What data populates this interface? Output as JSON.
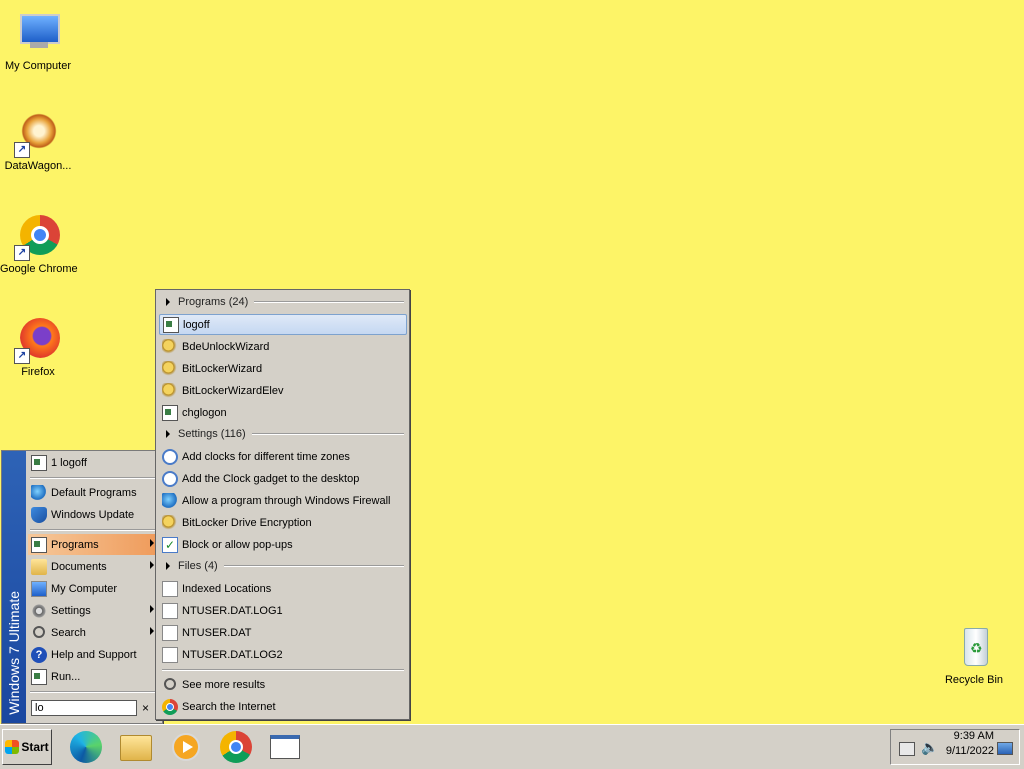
{
  "desktop": {
    "icons": [
      {
        "label": "My Computer"
      },
      {
        "label": "DataWagon..."
      },
      {
        "label": "Google Chrome"
      },
      {
        "label": "Firefox"
      },
      {
        "label": "Recycle Bin"
      }
    ]
  },
  "start_menu": {
    "band_text": "Windows 7 Ultimate",
    "recent_item": "1 logoff",
    "items": [
      {
        "label": "Default Programs"
      },
      {
        "label": "Windows Update"
      },
      {
        "label": "Programs"
      },
      {
        "label": "Documents"
      },
      {
        "label": "My Computer"
      },
      {
        "label": "Settings"
      },
      {
        "label": "Search"
      },
      {
        "label": "Help and Support"
      },
      {
        "label": "Run..."
      }
    ],
    "search_value": "lo",
    "clear_glyph": "×"
  },
  "results": {
    "programs_header": "Programs (24)",
    "programs": [
      "logoff",
      "BdeUnlockWizard",
      "BitLockerWizard",
      "BitLockerWizardElev",
      "chglogon"
    ],
    "settings_header": "Settings (116)",
    "settings": [
      "Add clocks for different time zones",
      "Add the Clock gadget to the desktop",
      "Allow a program through Windows Firewall",
      "BitLocker Drive Encryption",
      "Block or allow pop-ups"
    ],
    "files_header": "Files (4)",
    "files": [
      "Indexed Locations",
      "NTUSER.DAT.LOG1",
      "NTUSER.DAT",
      "NTUSER.DAT.LOG2"
    ],
    "see_more": "See more results",
    "search_internet": "Search the Internet"
  },
  "taskbar": {
    "start_label": "Start",
    "time": "9:39 AM",
    "date": "9/11/2022"
  }
}
